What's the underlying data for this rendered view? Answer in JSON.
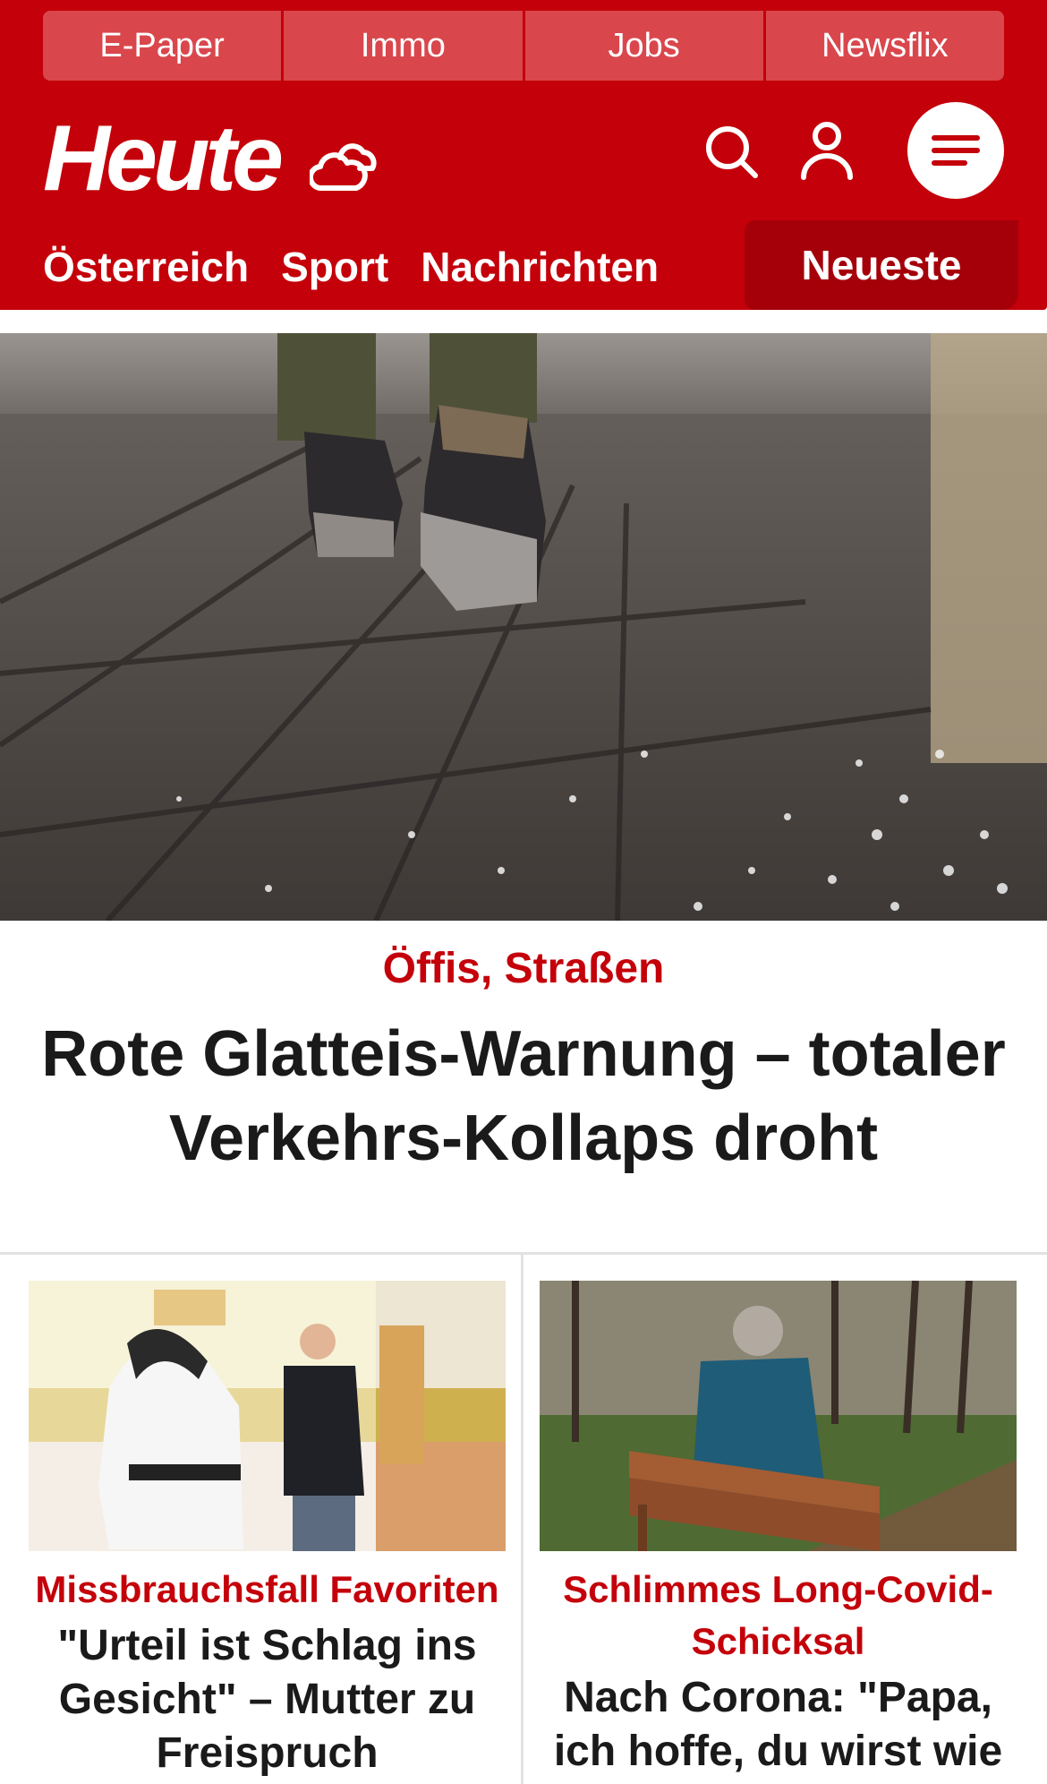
{
  "topnav": {
    "items": [
      "E-Paper",
      "Immo",
      "Jobs",
      "Newsflix"
    ]
  },
  "header": {
    "logo_text": "Heute",
    "weather_icon": "cloud-sun-icon",
    "search_icon": "search-icon",
    "user_icon": "user-icon",
    "menu_icon": "menu-icon"
  },
  "mainnav": {
    "items": [
      "Österreich",
      "Sport",
      "Nachrichten"
    ],
    "highlight": "Neueste"
  },
  "hero": {
    "kicker": "Öffis, Straßen",
    "title": "Rote Glatteis-Warnung – totaler Verkehrs-Kollaps droht"
  },
  "cards": [
    {
      "kicker": "Missbrauchsfall Favoriten",
      "title": "\"Urteil ist Schlag ins Gesicht\" – Mutter zu Freispruch"
    },
    {
      "kicker": "Schlimmes Long-Covid-Schicksal",
      "title": "Nach Corona: \"Papa, ich hoffe, du wirst wie"
    }
  ],
  "colors": {
    "brand_red": "#c4000a",
    "active_tab": "#a5000a",
    "topnav_tab": "#d9474d"
  }
}
